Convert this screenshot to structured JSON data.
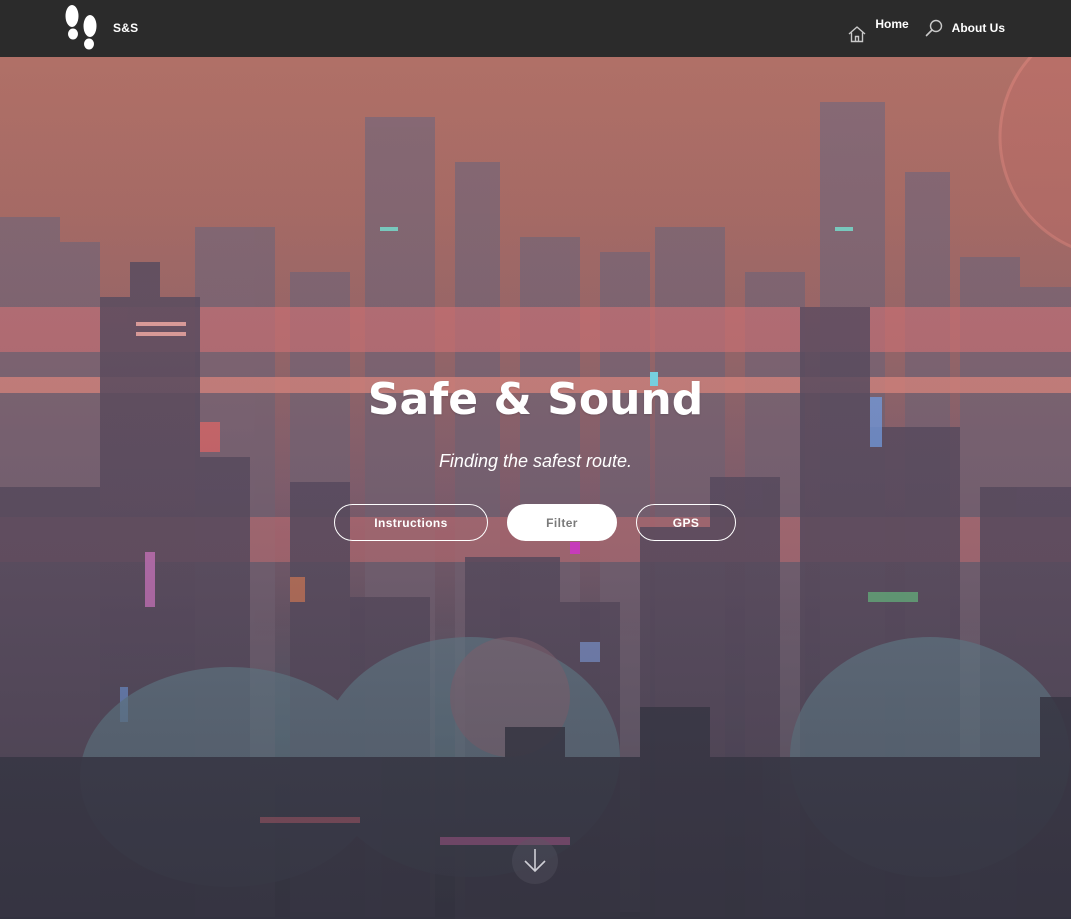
{
  "brand": {
    "name": "S&S",
    "logo_icon": "footprints-icon"
  },
  "nav": {
    "items": [
      {
        "label": "Home",
        "icon": "home-icon"
      },
      {
        "label": "About Us",
        "icon": "search-icon"
      }
    ]
  },
  "hero": {
    "title": "Safe & Sound",
    "subtitle": "Finding the safest route.",
    "buttons": [
      {
        "label": "Instructions"
      },
      {
        "label": "Filter"
      },
      {
        "label": "GPS"
      }
    ],
    "scroll_icon": "arrow-down-icon"
  },
  "colors": {
    "navbar": "#2b2b2b",
    "text": "#ffffff",
    "filter_button_text": "#7a7a7a"
  }
}
